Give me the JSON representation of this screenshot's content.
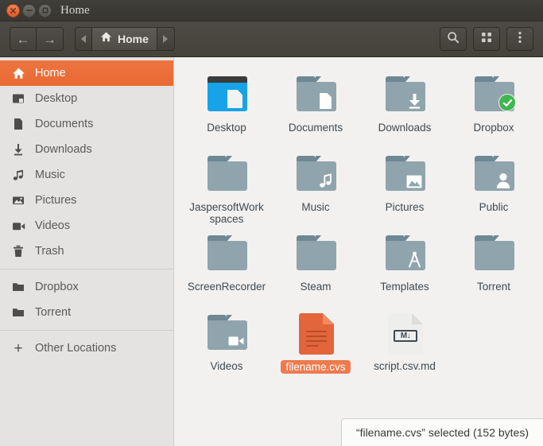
{
  "window": {
    "title": "Home",
    "controls": {
      "close": "close-button",
      "minimize": "minimize-button",
      "maximize": "maximize-button"
    }
  },
  "toolbar": {
    "back_label": "←",
    "forward_label": "→",
    "path_prev": "‹",
    "path_next": "›",
    "current_path": "Home",
    "search_label": "search-icon",
    "view_label": "grid-view-icon",
    "menu_label": "menu-icon"
  },
  "sidebar": {
    "places": [
      {
        "label": "Home",
        "icon": "home-icon",
        "active": true
      },
      {
        "label": "Desktop",
        "icon": "desktop-icon",
        "active": false
      },
      {
        "label": "Documents",
        "icon": "document-icon",
        "active": false
      },
      {
        "label": "Downloads",
        "icon": "download-icon",
        "active": false
      },
      {
        "label": "Music",
        "icon": "music-icon",
        "active": false
      },
      {
        "label": "Pictures",
        "icon": "picture-icon",
        "active": false
      },
      {
        "label": "Videos",
        "icon": "video-icon",
        "active": false
      },
      {
        "label": "Trash",
        "icon": "trash-icon",
        "active": false
      }
    ],
    "bookmarks": [
      {
        "label": "Dropbox",
        "icon": "folder-icon"
      },
      {
        "label": "Torrent",
        "icon": "folder-icon"
      }
    ],
    "other": {
      "label": "Other Locations",
      "icon": "plus-icon"
    }
  },
  "files": [
    {
      "name": "Desktop",
      "kind": "desktop",
      "glyph": "",
      "selected": false
    },
    {
      "name": "Documents",
      "kind": "folder",
      "glyph": "document",
      "selected": false
    },
    {
      "name": "Downloads",
      "kind": "folder",
      "glyph": "download",
      "selected": false
    },
    {
      "name": "Dropbox",
      "kind": "folder",
      "glyph": "",
      "badge": "check",
      "selected": false
    },
    {
      "name": "JaspersoftWorkspaces",
      "kind": "folder",
      "glyph": "",
      "selected": false
    },
    {
      "name": "Music",
      "kind": "folder",
      "glyph": "music",
      "selected": false
    },
    {
      "name": "Pictures",
      "kind": "folder",
      "glyph": "picture",
      "selected": false
    },
    {
      "name": "Public",
      "kind": "folder",
      "glyph": "person",
      "selected": false
    },
    {
      "name": "ScreenRecorder",
      "kind": "folder",
      "glyph": "",
      "selected": false
    },
    {
      "name": "Steam",
      "kind": "folder",
      "glyph": "",
      "selected": false
    },
    {
      "name": "Templates",
      "kind": "folder",
      "glyph": "compass",
      "selected": false
    },
    {
      "name": "Torrent",
      "kind": "folder",
      "glyph": "",
      "selected": false
    },
    {
      "name": "Videos",
      "kind": "folder",
      "glyph": "video",
      "selected": false
    },
    {
      "name": "filename.cvs",
      "kind": "doc-orange",
      "glyph": "textlines",
      "selected": true
    },
    {
      "name": "script.csv.md",
      "kind": "doc-white",
      "glyph": "markdown",
      "selected": false
    }
  ],
  "statusbar": {
    "text": "“filename.cvs” selected  (152 bytes)"
  },
  "colors": {
    "accent": "#ed7440",
    "selection": "#ed7b4e",
    "folder": "#90a4ad",
    "folder_tab": "#6e8894",
    "doc_orange": "#e2653c",
    "titlebar": "#3c3a34",
    "sidebar_bg": "#e4e3e1",
    "content_bg": "#f2f1f0",
    "badge_green": "#3fb64f"
  }
}
